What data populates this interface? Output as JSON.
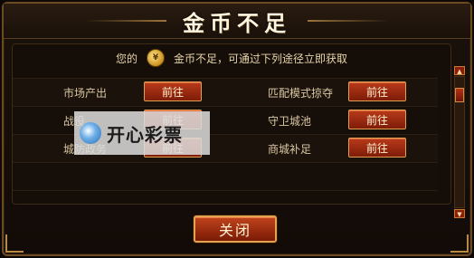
{
  "dialog": {
    "title": "金币不足",
    "notice_prefix": "您的",
    "notice_suffix": "金币不足，可通过下列途径立即获取",
    "close_label": "关闭"
  },
  "sources": [
    {
      "label": "市场产出",
      "button": "前往"
    },
    {
      "label": "匹配模式掠夺",
      "button": "前往"
    },
    {
      "label": "战役",
      "button": "前往"
    },
    {
      "label": "守卫城池",
      "button": "前往"
    },
    {
      "label": "城防政务",
      "button": "前往"
    },
    {
      "label": "商城补足",
      "button": "前往"
    }
  ],
  "watermark": {
    "text": "开心彩票"
  },
  "icons": {
    "coin": "gold-coin-icon",
    "scroll_up": "arrow-up-icon",
    "scroll_down": "arrow-down-icon"
  }
}
